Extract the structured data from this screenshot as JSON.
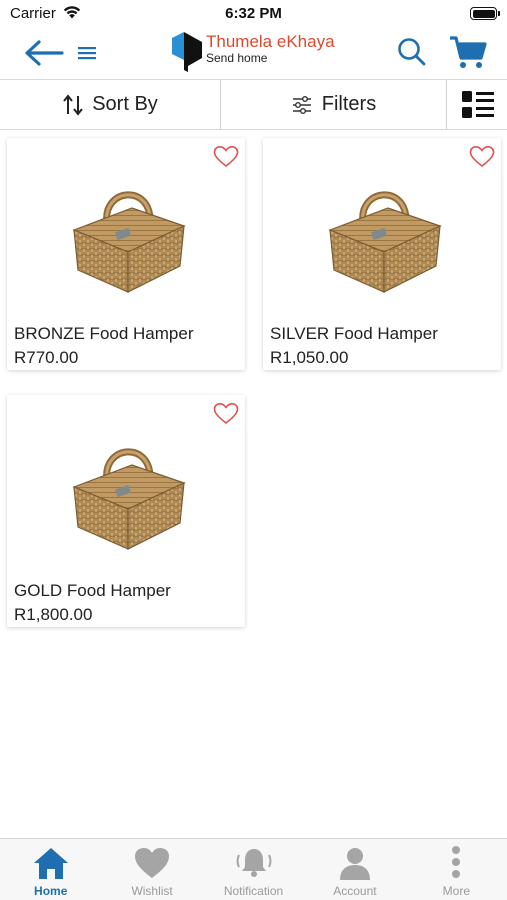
{
  "status_bar": {
    "carrier": "Carrier",
    "time": "6:32 PM"
  },
  "header": {
    "brand_name": "Thumela eKhaya",
    "brand_tagline": "Send home",
    "back_icon": "back-arrow-icon",
    "menu_icon": "hamburger-icon",
    "search_icon": "search-icon",
    "cart_icon": "cart-icon",
    "accent_color": "#1f6fb0",
    "brand_color": "#e0472c"
  },
  "toolbar": {
    "sort_label": "Sort By",
    "filter_label": "Filters",
    "view_icon": "list-view-icon"
  },
  "products": [
    {
      "name": "BRONZE Food Hamper",
      "price": "R770.00",
      "image": "picnic-basket-image",
      "wishlisted": false
    },
    {
      "name": "SILVER Food Hamper",
      "price": "R1,050.00",
      "image": "picnic-basket-image",
      "wishlisted": false
    },
    {
      "name": "GOLD Food Hamper",
      "price": "R1,800.00",
      "image": "picnic-basket-image",
      "wishlisted": false
    }
  ],
  "bottom_nav": [
    {
      "label": "Home",
      "icon": "home-icon",
      "active": true
    },
    {
      "label": "Wishlist",
      "icon": "heart-icon",
      "active": false
    },
    {
      "label": "Notification",
      "icon": "bell-icon",
      "active": false
    },
    {
      "label": "Account",
      "icon": "user-icon",
      "active": false
    },
    {
      "label": "More",
      "icon": "more-vertical-icon",
      "active": false
    }
  ]
}
